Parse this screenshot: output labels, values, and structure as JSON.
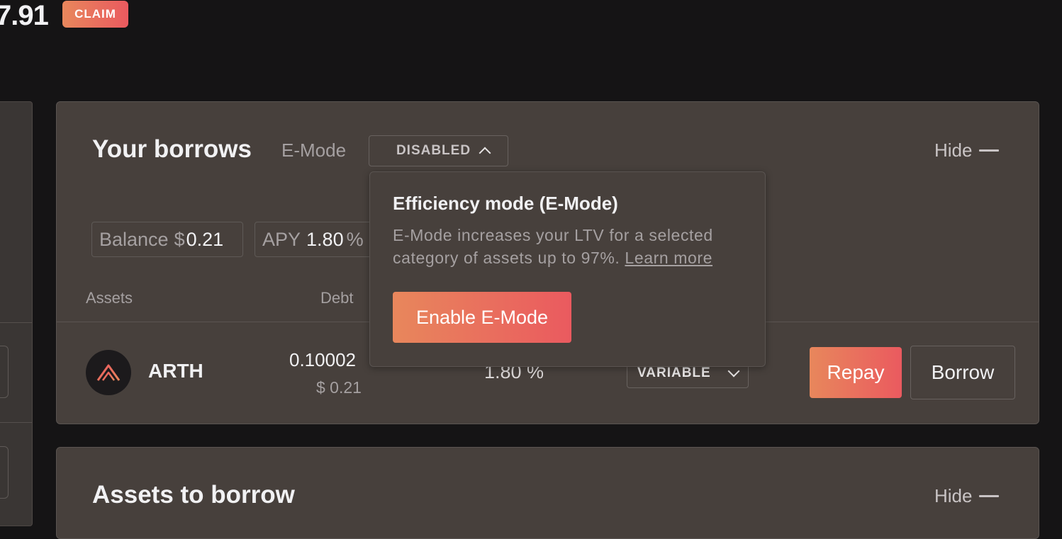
{
  "header": {
    "value_partial": "7.91",
    "claim_label": "CLAIM"
  },
  "borrows": {
    "title": "Your borrows",
    "emode_label": "E-Mode",
    "emode_status": "DISABLED",
    "hide_label": "Hide",
    "balance_label": "Balance",
    "balance_currency": "$",
    "balance_value": "0.21",
    "apy_label": "APY",
    "apy_value": "1.80",
    "apy_unit": "%",
    "columns": {
      "assets": "Assets",
      "debt": "Debt"
    },
    "rows": [
      {
        "asset": "ARTH",
        "debt": "0.10002",
        "debt_usd": "$ 0.21",
        "apy": "1.80 %",
        "rate_type": "VARIABLE",
        "repay_label": "Repay",
        "borrow_label": "Borrow"
      }
    ]
  },
  "emode_popover": {
    "title": "Efficiency mode (E-Mode)",
    "description": "E-Mode increases your LTV for a selected category of assets up to 97%.",
    "learn_more": "Learn more",
    "enable_label": "Enable E-Mode"
  },
  "assets_to_borrow": {
    "title": "Assets to borrow",
    "hide_label": "Hide"
  },
  "colors": {
    "background": "#151415",
    "panel": "#47403c",
    "accent_gradient_start": "#e8875c",
    "accent_gradient_end": "#ea5a5f"
  },
  "icons": {
    "arth": "arth-logo-icon",
    "emode_toggle": "chevron-up-icon",
    "rate_select": "chevron-down-icon",
    "hide": "minus-icon"
  }
}
